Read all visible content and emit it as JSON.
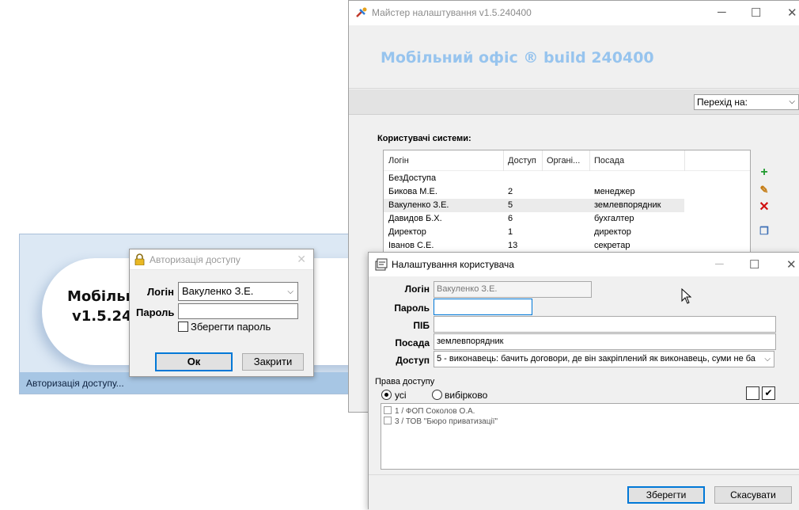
{
  "splash": {
    "title_line1": "Мобільн",
    "title_line2": "v1.5.24",
    "status": "Авторизація доступу..."
  },
  "auth": {
    "title": "Авторизація доступу",
    "login_label": "Логін",
    "login_value": "Вакуленко З.Е.",
    "password_label": "Пароль",
    "password_value": "",
    "remember_label": "Зберегти пароль",
    "ok_label": "Ок",
    "close_label": "Закрити"
  },
  "wizard": {
    "title": "Майстер налаштування v1.5.240400",
    "banner": "Мобільний офіс ® build 240400",
    "nav_select": "Перехід на:",
    "users_label": "Користувачі системи:",
    "columns": [
      "Логін",
      "Доступ",
      "Органі...",
      "Посада"
    ],
    "rows": [
      {
        "login": "БезДоступа",
        "access": "",
        "org": "",
        "position": ""
      },
      {
        "login": "Бикова М.Е.",
        "access": "2",
        "org": "",
        "position": "менеджер"
      },
      {
        "login": "Вакуленко З.Е.",
        "access": "5",
        "org": "",
        "position": "землевпорядник"
      },
      {
        "login": "Давидов Б.Х.",
        "access": "6",
        "org": "",
        "position": "бухгалтер"
      },
      {
        "login": "Директор",
        "access": "1",
        "org": "",
        "position": "директор"
      },
      {
        "login": "Іванов С.Е.",
        "access": "13",
        "org": "",
        "position": "секретар"
      }
    ],
    "colors": {
      "banner_text": "#97c4ee",
      "add": "#1f9a2e",
      "delete": "#d01010"
    }
  },
  "user_dialog": {
    "title": "Налаштування користувача",
    "login_label": "Логін",
    "login_value": "Вакуленко З.Е.",
    "password_label": "Пароль",
    "password_value": "",
    "pib_label": "ПІБ",
    "pib_value": "",
    "position_label": "Посада",
    "position_value": "землевпорядник",
    "access_label": "Доступ",
    "access_value": "5 - виконавець: бачить договори, де він закріплений як виконавець, суми не ба",
    "rights_label": "Права доступу",
    "radio_all": "усі",
    "radio_selective": "вибірково",
    "orgs": [
      "1 /  ФОП Соколов О.А.",
      "3 /  ТОВ \"Бюро приватизації\""
    ],
    "save_label": "Зберегти",
    "cancel_label": "Скасувати"
  }
}
